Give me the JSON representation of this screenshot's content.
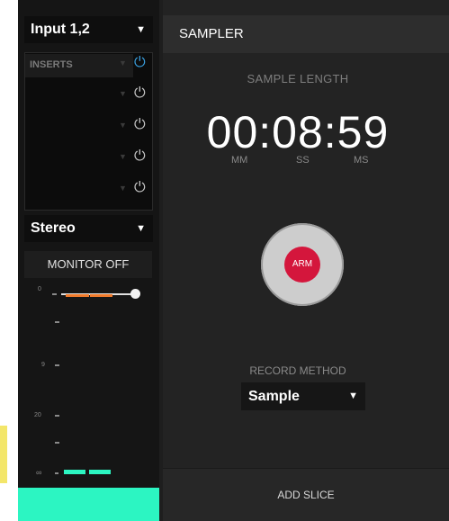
{
  "input_selector": {
    "value": "Input 1,2",
    "arrow": "▼"
  },
  "inserts": {
    "label": "INSERTS",
    "rows": [
      {
        "power_icon": "power-icon",
        "active": true
      },
      {
        "power_icon": "power-icon",
        "active": false
      },
      {
        "power_icon": "power-icon",
        "active": false
      },
      {
        "power_icon": "power-icon",
        "active": false
      },
      {
        "power_icon": "power-icon",
        "active": false
      }
    ]
  },
  "output_selector": {
    "value": "Stereo",
    "arrow": "▼"
  },
  "monitor": {
    "label": "MONITOR OFF"
  },
  "meter_scale": {
    "top": "0",
    "mid": "9",
    "low": "20",
    "bottom": "∞"
  },
  "colors": {
    "accent_teal": "#2cf5c2",
    "power_active": "#3aa0e0",
    "arm_red": "#d4163c",
    "level_orange": "#f07a2a"
  },
  "sampler": {
    "title": "SAMPLER",
    "sample_length_label": "SAMPLE LENGTH",
    "timer": "00:08:59",
    "units": [
      "MM",
      "SS",
      "MS"
    ],
    "arm_label": "ARM",
    "record_method_label": "RECORD METHOD",
    "record_method_value": "Sample",
    "record_method_arrow": "▼",
    "add_slice_label": "ADD SLICE"
  }
}
